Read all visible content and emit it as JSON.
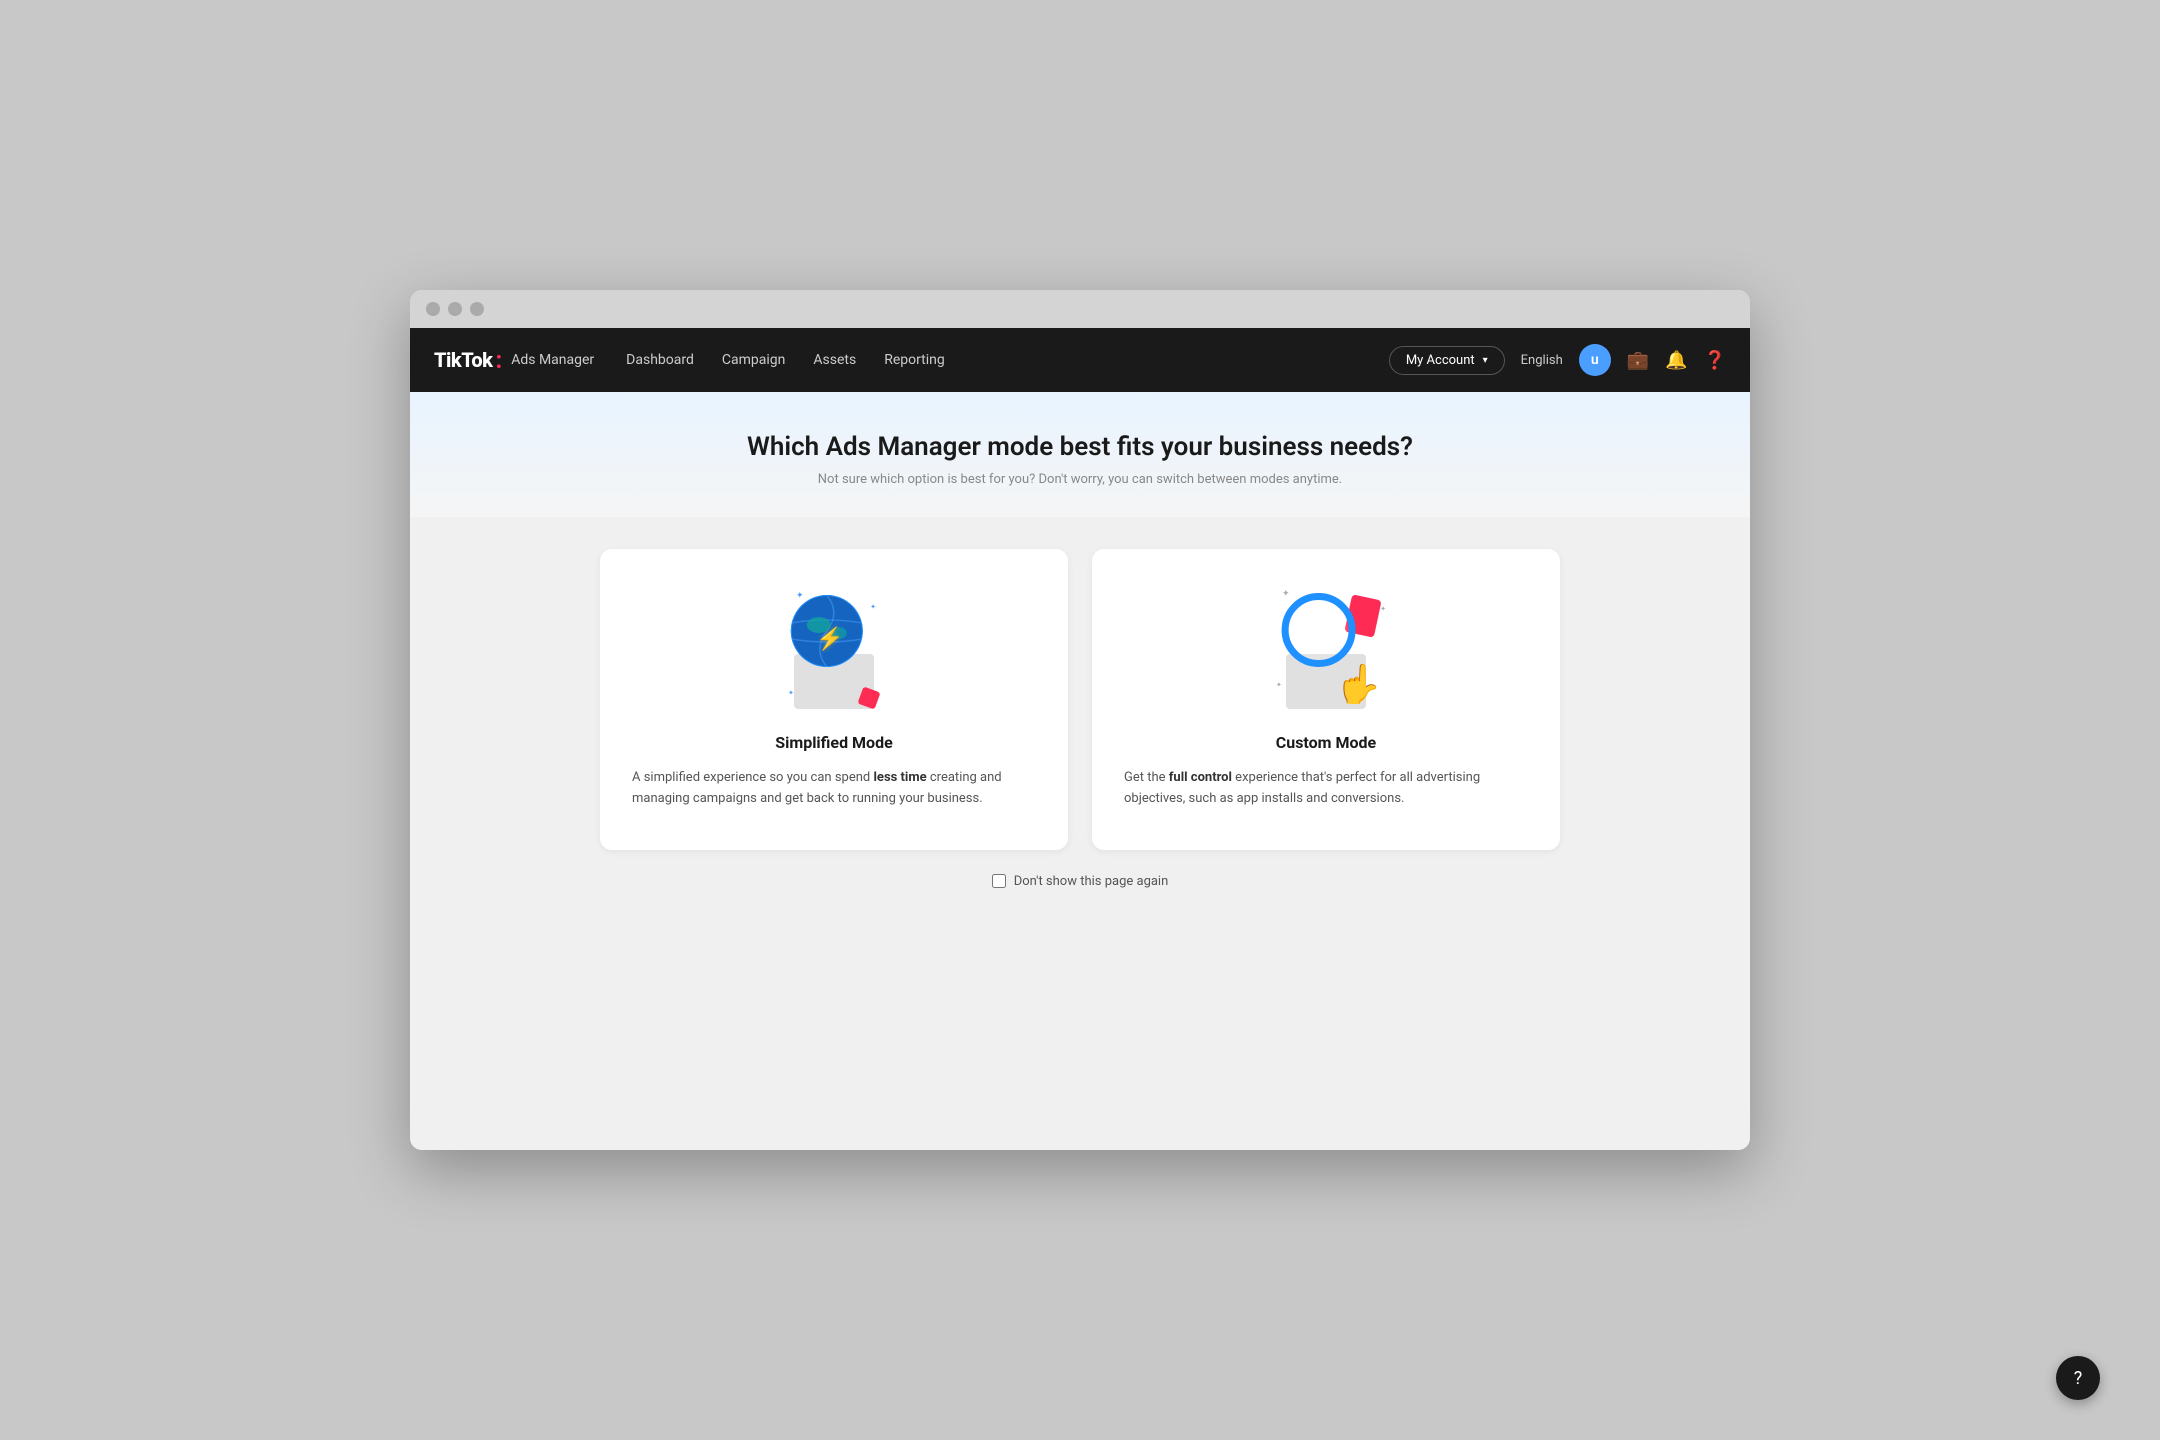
{
  "browser": {
    "traffic_lights": [
      "close",
      "minimize",
      "maximize"
    ]
  },
  "navbar": {
    "brand": {
      "tiktok": "TikTok",
      "dot": ":",
      "ads_manager": "Ads Manager"
    },
    "nav_items": [
      {
        "label": "Dashboard",
        "key": "dashboard"
      },
      {
        "label": "Campaign",
        "key": "campaign"
      },
      {
        "label": "Assets",
        "key": "assets"
      },
      {
        "label": "Reporting",
        "key": "reporting"
      }
    ],
    "my_account_label": "My Account",
    "language": "English",
    "user_initial": "u"
  },
  "hero": {
    "title": "Which Ads Manager mode best fits your business needs?",
    "subtitle": "Not sure which option is best for you? Don't worry, you can switch between modes anytime."
  },
  "cards": [
    {
      "key": "simplified",
      "title": "Simplified Mode",
      "description_parts": [
        "A simplified experience so you can spend ",
        "less time",
        " creating and managing campaigns and get back to running your business."
      ]
    },
    {
      "key": "custom",
      "title": "Custom Mode",
      "description_parts": [
        "Get the ",
        "full control",
        " experience that's perfect for all advertising objectives, such as app installs and conversions."
      ]
    }
  ],
  "footer": {
    "checkbox_label": "Don't show this page again"
  },
  "help": {
    "icon": "?"
  }
}
